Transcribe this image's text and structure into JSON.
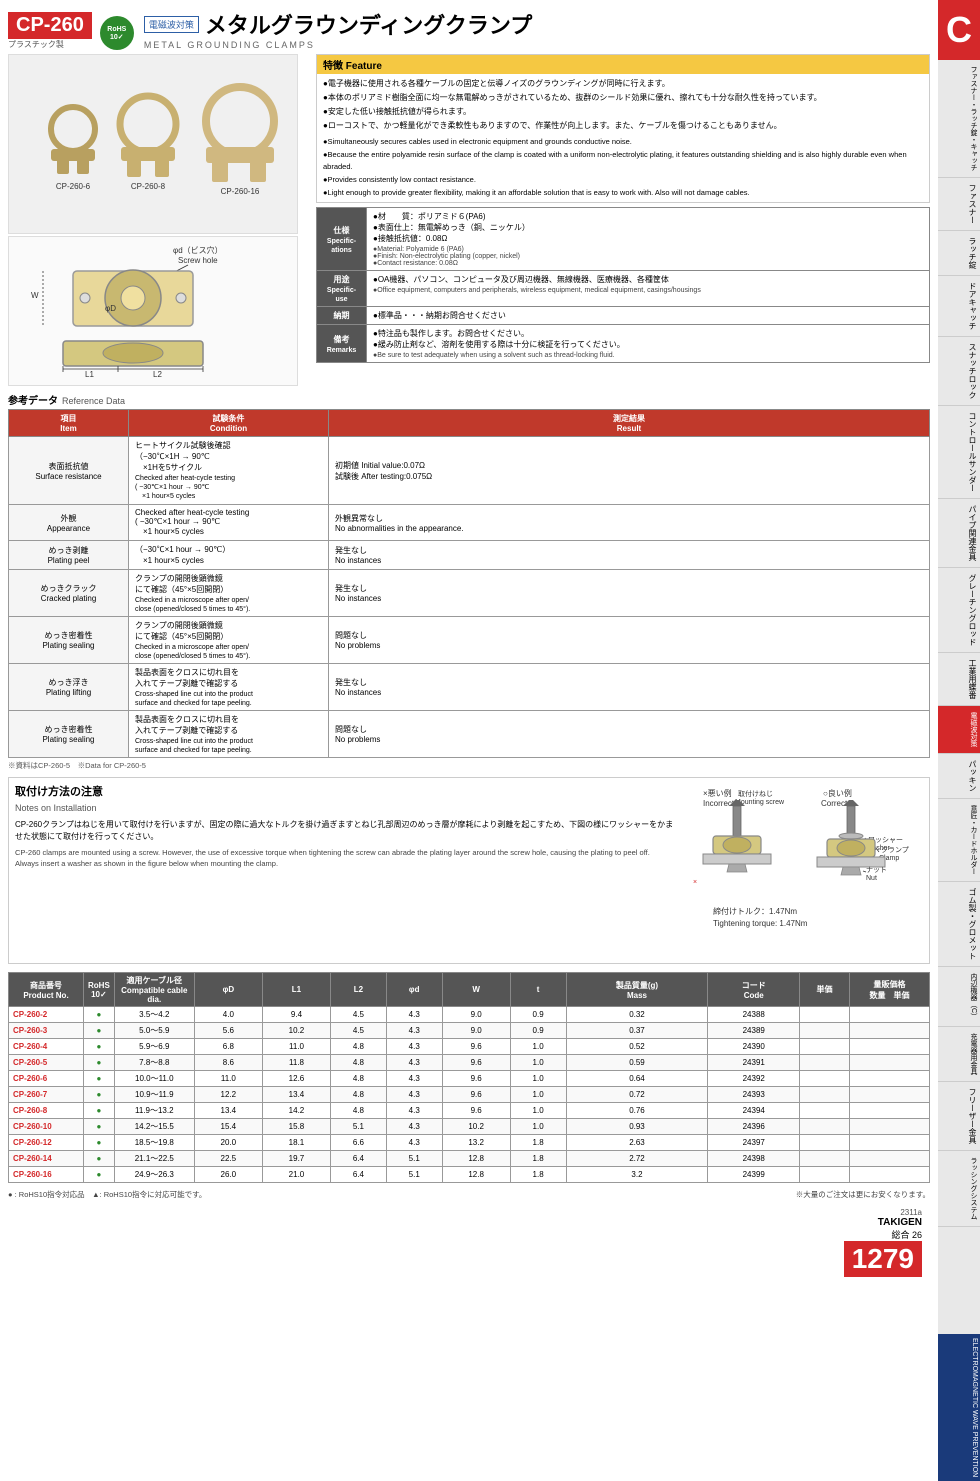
{
  "header": {
    "product_code": "CP-260",
    "product_subtitle": "プラスチック製",
    "rohs_label": "RoHS\n10✓",
    "title_jp": "メタルグラウンディングクランプ",
    "title_en": "METAL GROUNDING CLAMPS",
    "em_label": "電磁波対策"
  },
  "product_variants": [
    "CP-260-6",
    "CP-260-8",
    "CP-260-16"
  ],
  "features": {
    "header": "特徴  Feature",
    "items_jp": [
      "電子機器に使用される各種ケーブルの固定と伝導ノイズのグラウンディングが同時に行えます。",
      "本体のポリアミド樹脂全面に均一な無電解めっきがされているため、抜群のシールド効果に優れ、擦れても十分な耐久性を持っています。",
      "安定した低い接触抵抗値が得られます。",
      "ローコストで、かつ軽量化ができ柔軟性もありますので、作業性が向上します。また、ケーブルを傷つけることもありません。"
    ],
    "items_en": [
      "Simultaneously secures cables used in electronic equipment and grounds conductive noise.",
      "Because the entire polyamide resin surface of the clamp is coated with a uniform non-electrolytic plating, it features outstanding shielding and is also highly durable even when abraded.",
      "Provides consistently low contact resistance.",
      "Light enough to provide greater flexibility, making it an affordable solution that is easy to work with. Also will not damage cables."
    ]
  },
  "specifications": {
    "label": "仕様",
    "rows": [
      {
        "label": "仕様",
        "value_jp": "●材　　質：ポリアミド６(PA6)\n●表面仕上：無電解めっき（銅、ニッケル）\n●接触抵抗値：0.08Ω",
        "value_en": "Material: Polyamide 6 (PA6)\nFinish: Non-electrolytic plating (copper, nickel)\nContact resistance: 0.08Ω"
      },
      {
        "label": "用途",
        "value_jp": "●OA機器、パソコン、コンピュータ及び周辺機器、無線機器、医療機器、各種筐体",
        "value_en": "Office equipment, computers and peripherals, wireless equipment, medical equipment, casings/housings"
      },
      {
        "label": "納期",
        "value_jp": "●標準品・・・納期お問合せください",
        "value_en": ""
      },
      {
        "label": "備考",
        "value_jp": "●特注品も製作します。お問合せください。\n●緩み防止剤など、溶剤を使用する際は十分に検証を行ってください。",
        "value_en": "Be sure to test adequately when using a solvent such as thread-locking fluid."
      }
    ]
  },
  "reference_data": {
    "title_jp": "参考データ",
    "title_en": "Reference Data",
    "footnote": "※資料はCP-260-5　※Data for CP-260-5",
    "columns": [
      "項目\nItem",
      "試験条件\nCondition",
      "測定結果\nResult"
    ],
    "rows": [
      {
        "item_jp": "表面抵抗値\nSurface resistance",
        "item_en": "Surface resistance",
        "condition_jp": "ヒートサイクル試験後確認\n（−30℃×1H → 90℃\n　×1Hを5サイクル",
        "condition_en": "Checked after heat-cycle testing\n( −30℃×1 hour → 90℃\n　×1 hour×5 cycles",
        "result_jp": "初期値 Initial value:0.07Ω\n試験後 After testing:0.075Ω",
        "result_en": "Initial value: 0.07Ω\nAfter testing: 0.075Ω"
      },
      {
        "item_jp": "外観\nAppearance",
        "item_en": "Appearance",
        "condition_jp": "Checked after heat-cycle testing\n( −30℃×1 hour → 90℃\n　×1 hour×5 cycles",
        "result_jp": "外観異常なし\nNo abnormalities in the appearance.",
        "result_en": "No abnormalities in the appearance."
      },
      {
        "item_jp": "めっき剥離\nPlating peel",
        "item_en": "Plating peel",
        "condition_jp": "（−30℃×1 hour → 90℃）\n　×1 hour×5 cycles",
        "result_jp": "発生なし\nNo instances",
        "result_en": "No instances"
      },
      {
        "item_jp": "めっきクラック\nCracked plating",
        "item_en": "Cracked plating",
        "condition_jp": "クランプの開閉後顕微鏡\nにて確認（45°×5回開閉）",
        "condition_en": "Checked in a microscope after open/close (opened/closed 5 times to 45°).",
        "result_jp": "発生なし\nNo instances",
        "result_en": "No instances"
      },
      {
        "item_jp": "めっき密着性\nPlating sealing",
        "item_en": "Plating sealing",
        "condition_jp": "クランプの開閉後顕微鏡\nにて確認（45°×5回開閉）",
        "condition_en": "Checked in a microscope after open/close (opened/closed 5 times to 45°).",
        "result_jp": "問題なし\nNo problems",
        "result_en": "No problems"
      },
      {
        "item_jp": "めっき浮き\nPlating lifting",
        "item_en": "Plating lifting",
        "condition_jp": "製品表面をクロスに切れ目を\n入れてテープ剥離で確認する",
        "condition_en": "Cross-shaped line cut into the product surface and checked for tape peeling.",
        "result_jp": "発生なし\nNo instances",
        "result_en": "No instances"
      },
      {
        "item_jp": "めっき密着性\nPlating sealing",
        "item_en": "Plating sealing",
        "condition_jp": "製品表面をクロスに切れ目を\n入れてテープ剥離で確認する",
        "condition_en": "Cross-shaped line cut into the product surface and checked for tape peeling.",
        "result_jp": "問題なし\nNo problems",
        "result_en": "No problems"
      }
    ]
  },
  "installation_notes": {
    "title_jp": "取付け方法の注意",
    "title_en": "Notes on Installation",
    "text_jp": "CP-260クランプはねじを用いて取付けを行いますが、固定の際に過大なトルクを掛け過ぎますとねじ孔部周辺のめっき層が摩耗により剥離を起こすため、下図の様にワッシャーをかませた状態にて取付けを行ってください。",
    "text_en": "CP-260 clamps are mounted using a screw. However, the use of excessive torque when tightening the screw can abrade the plating layer around the screw hole, causing the plating to peel off. Always insert a washer as shown in the figure below when mounting the clamp.",
    "torque": "締付けトルク：1.47Nm",
    "torque_en": "Tightening torque: 1.47Nm",
    "bad_label": "×悪い例\nIncorrect",
    "good_label": "○良い例\nCorrect",
    "labels": {
      "mounting_screw": "取付けねじ\nMounting screw",
      "washer": "ワッシャー\nWasher",
      "clamp": "クランプ\nClamp",
      "nut": "ナット\nNut"
    }
  },
  "product_table": {
    "headers": [
      "商品番号\nProduct No.",
      "RoHS\n10✓",
      "適用ケーブル径\nCompatible cable dia.",
      "φD",
      "L1",
      "L2",
      "φd",
      "W",
      "t",
      "製品質量(g)\nMass",
      "コード\nCode",
      "単価",
      "量販価格\n数量　単価"
    ],
    "rows": [
      {
        "pn": "CP-260-2",
        "rohs": "●",
        "cable": "3.5〜4.2",
        "phiD": "4.0",
        "L1": "9.4",
        "L2": "4.5",
        "phid": "4.3",
        "W": "9.0",
        "t": "0.9",
        "mass": "0.32",
        "code": "24388",
        "unit": "",
        "bulk": ""
      },
      {
        "pn": "CP-260-3",
        "rohs": "●",
        "cable": "5.0〜5.9",
        "phiD": "5.6",
        "L1": "10.2",
        "L2": "4.5",
        "phid": "4.3",
        "W": "9.0",
        "t": "0.9",
        "mass": "0.37",
        "code": "24389",
        "unit": "",
        "bulk": ""
      },
      {
        "pn": "CP-260-4",
        "rohs": "●",
        "cable": "5.9〜6.9",
        "phiD": "6.8",
        "L1": "11.0",
        "L2": "4.8",
        "phid": "4.3",
        "W": "9.6",
        "t": "1.0",
        "mass": "0.52",
        "code": "24390",
        "unit": "",
        "bulk": ""
      },
      {
        "pn": "CP-260-5",
        "rohs": "●",
        "cable": "7.8〜8.8",
        "phiD": "8.6",
        "L1": "11.8",
        "L2": "4.8",
        "phid": "4.3",
        "W": "9.6",
        "t": "1.0",
        "mass": "0.59",
        "code": "24391",
        "unit": "",
        "bulk": ""
      },
      {
        "pn": "CP-260-6",
        "rohs": "●",
        "cable": "10.0〜11.0",
        "phiD": "11.0",
        "L1": "12.6",
        "L2": "4.8",
        "phid": "4.3",
        "W": "9.6",
        "t": "1.0",
        "mass": "0.64",
        "code": "24392",
        "unit": "",
        "bulk": ""
      },
      {
        "pn": "CP-260-7",
        "rohs": "●",
        "cable": "10.9〜11.9",
        "phiD": "12.2",
        "L1": "13.4",
        "L2": "4.8",
        "phid": "4.3",
        "W": "9.6",
        "t": "1.0",
        "mass": "0.72",
        "code": "24393",
        "unit": "",
        "bulk": ""
      },
      {
        "pn": "CP-260-8",
        "rohs": "●",
        "cable": "11.9〜13.2",
        "phiD": "13.4",
        "L1": "14.2",
        "L2": "4.8",
        "phid": "4.3",
        "W": "9.6",
        "t": "1.0",
        "mass": "0.76",
        "code": "24394",
        "unit": "",
        "bulk": ""
      },
      {
        "pn": "CP-260-10",
        "rohs": "●",
        "cable": "14.2〜15.5",
        "phiD": "15.4",
        "L1": "15.8",
        "L2": "5.1",
        "phid": "4.3",
        "W": "10.2",
        "t": "1.0",
        "mass": "0.93",
        "code": "24396",
        "unit": "",
        "bulk": ""
      },
      {
        "pn": "CP-260-12",
        "rohs": "●",
        "cable": "18.5〜19.8",
        "phiD": "20.0",
        "L1": "18.1",
        "L2": "6.6",
        "phid": "4.3",
        "W": "13.2",
        "t": "1.8",
        "mass": "2.63",
        "code": "24397",
        "unit": "",
        "bulk": ""
      },
      {
        "pn": "CP-260-14",
        "rohs": "●",
        "cable": "21.1〜22.5",
        "phiD": "22.5",
        "L1": "19.7",
        "L2": "6.4",
        "phid": "5.1",
        "W": "12.8",
        "t": "1.8",
        "mass": "2.72",
        "code": "24398",
        "unit": "",
        "bulk": ""
      },
      {
        "pn": "CP-260-16",
        "rohs": "●",
        "cable": "24.9〜26.3",
        "phiD": "26.0",
        "L1": "21.0",
        "L2": "6.4",
        "phid": "5.1",
        "W": "12.8",
        "t": "1.8",
        "mass": "3.2",
        "code": "24399",
        "unit": "",
        "bulk": ""
      }
    ]
  },
  "footnotes": {
    "rohs10": "● : RoHS10指令対応品　▲: RoHS10指令に対応可能です。",
    "bulk": "※大量のご注文は更にお安くなります。"
  },
  "page": {
    "catalog_ref": "2311a",
    "brand": "TAKIGEN",
    "catalog_label": "総合 26",
    "page_number": "1279"
  },
  "sidebar": {
    "letter": "C",
    "sections": [
      "ファスナー・ラッチ錠・キャッチ",
      "ファスナー",
      "ラッチ錠",
      "ドアキャッチ",
      "スナッチロック",
      "コントロールサンダー",
      "パイプ関連金具",
      "グレーチングロッド",
      "工業用蝶番",
      "電磁波対策",
      "パッキン",
      "意匠・カードホルダー",
      "ゴム製・グロメット",
      "内辺機器（C）",
      "充電器用金具",
      "フリーザー金具",
      "ラッシングシステム"
    ]
  }
}
